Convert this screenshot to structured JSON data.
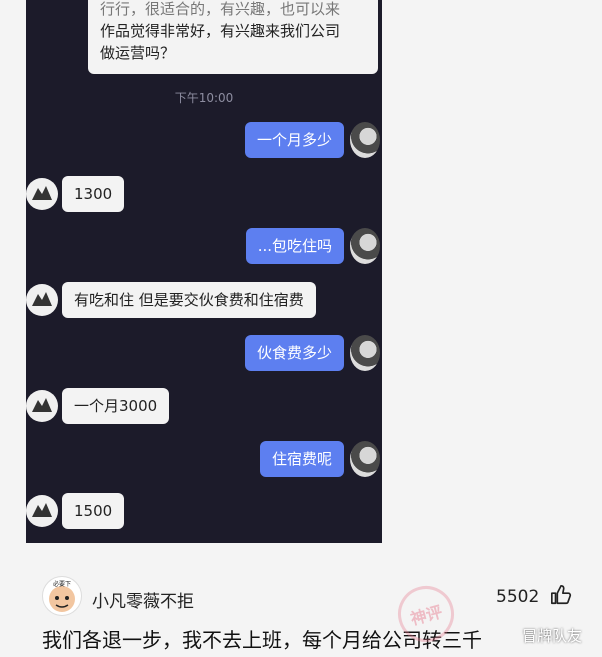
{
  "chat": {
    "first_message_line1": "作品觉得非常好，有兴趣来我们公司",
    "first_message_line2": "做运营吗？",
    "first_message_partial": "行行，很适合的，有兴趣，也可以来",
    "time": "下午10:00",
    "messages": [
      {
        "side": "right",
        "text": "一个月多少"
      },
      {
        "side": "left",
        "text": "1300"
      },
      {
        "side": "right",
        "text": "...包吃住吗"
      },
      {
        "side": "left",
        "text": "有吃和住 但是要交伙食费和住宿费"
      },
      {
        "side": "right",
        "text": "伙食费多少"
      },
      {
        "side": "left",
        "text": "一个月3000"
      },
      {
        "side": "right",
        "text": "住宿费呢"
      },
      {
        "side": "left",
        "text": "1500"
      }
    ],
    "left_avatar_icon": "logo-avatar-icon",
    "right_avatar_icon": "user-avatar-icon"
  },
  "comment": {
    "username": "小凡零薇不拒",
    "avatar_text": "必要下",
    "likes": "5502",
    "like_icon": "thumbs-up-icon",
    "text": "我们各退一步，我不去上班，每个月给公司转三千"
  },
  "stamp": {
    "text": "神评"
  },
  "watermark": {
    "text": "冒牌队友"
  }
}
